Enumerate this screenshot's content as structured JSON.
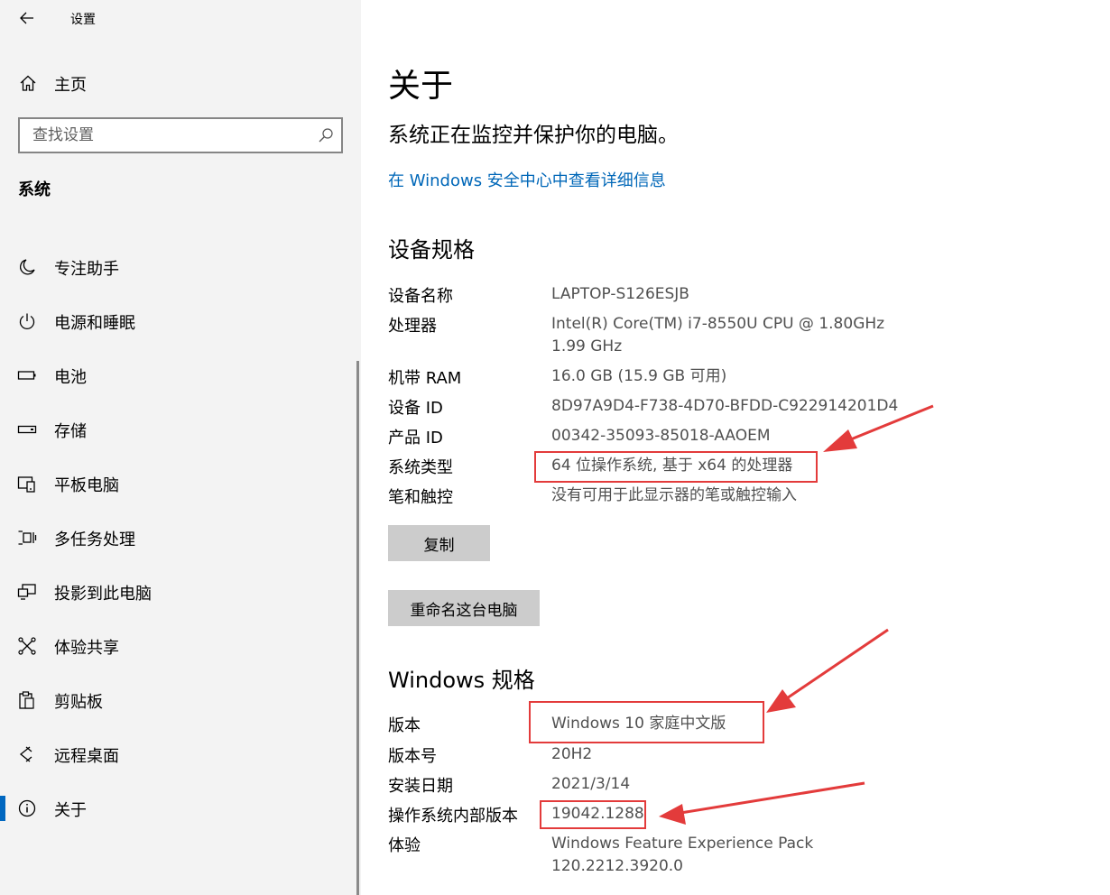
{
  "window": {
    "title": "设置"
  },
  "sidebar": {
    "home_label": "主页",
    "search_placeholder": "查找设置",
    "section_title": "系统",
    "items": [
      {
        "label": "专注助手",
        "icon": "moon-icon"
      },
      {
        "label": "电源和睡眠",
        "icon": "power-icon"
      },
      {
        "label": "电池",
        "icon": "battery-icon"
      },
      {
        "label": "存储",
        "icon": "storage-icon"
      },
      {
        "label": "平板电脑",
        "icon": "tablet-icon"
      },
      {
        "label": "多任务处理",
        "icon": "multitasking-icon"
      },
      {
        "label": "投影到此电脑",
        "icon": "projecting-icon"
      },
      {
        "label": "体验共享",
        "icon": "shared-experiences-icon"
      },
      {
        "label": "剪贴板",
        "icon": "clipboard-icon"
      },
      {
        "label": "远程桌面",
        "icon": "remote-desktop-icon"
      },
      {
        "label": "关于",
        "icon": "info-icon",
        "selected": true
      }
    ]
  },
  "main": {
    "title": "关于",
    "status": "系统正在监控并保护你的电脑。",
    "security_link": "在 Windows 安全中心中查看详细信息",
    "device_specs": {
      "heading": "设备规格",
      "rows": [
        {
          "label": "设备名称",
          "value": "LAPTOP-S126ESJB"
        },
        {
          "label": "处理器",
          "value": "Intel(R) Core(TM) i7-8550U CPU @ 1.80GHz",
          "value2": "1.99 GHz"
        },
        {
          "label": "机带 RAM",
          "value": "16.0 GB (15.9 GB 可用)"
        },
        {
          "label": "设备 ID",
          "value": "8D97A9D4-F738-4D70-BFDD-C922914201D4"
        },
        {
          "label": "产品 ID",
          "value": "00342-35093-85018-AAOEM"
        },
        {
          "label": "系统类型",
          "value": "64 位操作系统, 基于 x64 的处理器"
        },
        {
          "label": "笔和触控",
          "value": "没有可用于此显示器的笔或触控输入"
        }
      ],
      "copy_button": "复制",
      "rename_button": "重命名这台电脑"
    },
    "windows_specs": {
      "heading": "Windows 规格",
      "rows": [
        {
          "label": "版本",
          "value": "Windows 10 家庭中文版"
        },
        {
          "label": "版本号",
          "value": "20H2"
        },
        {
          "label": "安装日期",
          "value": "2021/3/14"
        },
        {
          "label": "操作系统内部版本",
          "value": "19042.1288"
        },
        {
          "label": "体验",
          "value": "Windows Feature Experience Pack",
          "value2": "120.2212.3920.0"
        }
      ]
    }
  },
  "colors": {
    "sidebar_bg": "#f3f3f3",
    "accent": "#0067c0",
    "link": "#0067b8",
    "annotation": "#e33b3b",
    "button_bg": "#cccccc"
  }
}
